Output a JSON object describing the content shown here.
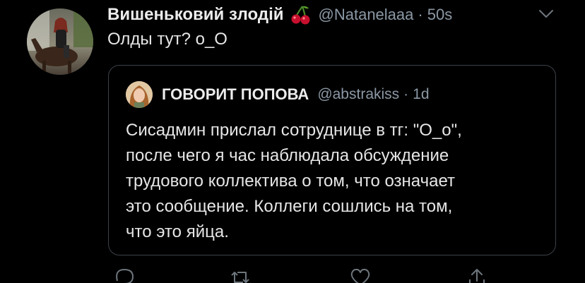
{
  "tweet": {
    "display_name": "Вишеньковий злодій",
    "name_emoji": "cherries-icon",
    "handle": "@Natanelaaa",
    "separator": "·",
    "time": "50s",
    "text": "Олды тут? о_О",
    "menu_icon": "chevron-down-icon"
  },
  "quoted": {
    "display_name": "ГОВОРИТ ПОПОВА",
    "handle": "@abstrakiss",
    "separator": "·",
    "time": "1d",
    "lines": [
      "Сисадмин прислал сотруднице в тг: \"О_о\",",
      "после чего я час наблюдала обсуждение",
      "трудового коллектива о том, что означает",
      "это сообщение. Коллеги сошлись на том,",
      "что это яйца."
    ]
  },
  "actions": [
    "reply-icon",
    "retweet-icon",
    "like-icon",
    "share-icon"
  ],
  "colors": {
    "background": "#000000",
    "text": "#e6e6e6",
    "muted": "#8b98a5",
    "border": "#3c4248",
    "cherry": "#c8102e"
  }
}
